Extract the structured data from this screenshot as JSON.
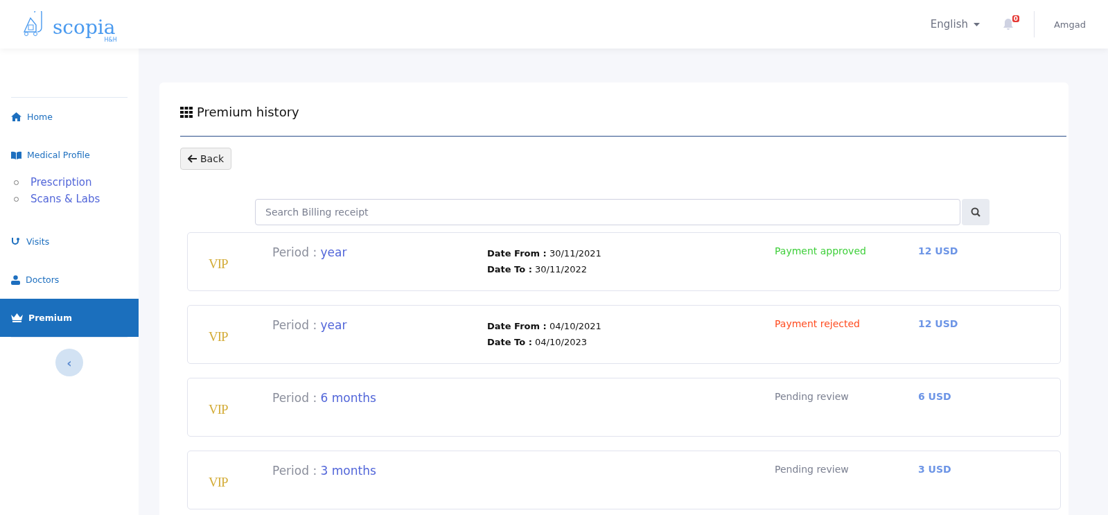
{
  "header": {
    "logo": {
      "name": "scopia",
      "tagline": "H&H"
    },
    "language": "English",
    "notifications": "0",
    "user": "Amgad"
  },
  "sidebar": {
    "items": [
      {
        "label": "Home",
        "selected": false
      },
      {
        "label": "Medical Profile",
        "selected": false,
        "children": [
          {
            "label": "Prescription"
          },
          {
            "label": "Scans & Labs"
          }
        ]
      },
      {
        "label": "Visits",
        "selected": false
      },
      {
        "label": "Doctors",
        "selected": false
      },
      {
        "label": "Premium",
        "selected": true
      }
    ],
    "collapse": "‹"
  },
  "page": {
    "title": "Premium history",
    "back": "Back",
    "search": {
      "placeholder": "Search Billing receipt"
    },
    "rows": [
      {
        "badge": "VIP",
        "period_label": "Period :",
        "period": "year",
        "date_from_label": "Date From :",
        "date_from": "30/11/2021",
        "date_to_label": "Date To :",
        "date_to": "30/11/2022",
        "status": "Payment approved",
        "kind": "approved",
        "amount": "12 USD"
      },
      {
        "badge": "VIP",
        "period_label": "Period :",
        "period": "year",
        "date_from_label": "Date From :",
        "date_from": "04/10/2021",
        "date_to_label": "Date To :",
        "date_to": "04/10/2023",
        "status": "Payment rejected",
        "kind": "rejected",
        "amount": "12 USD"
      },
      {
        "badge": "VIP",
        "period_label": "Period :",
        "period": "6 months",
        "status": "Pending review",
        "kind": "pending",
        "amount": "6 USD"
      },
      {
        "badge": "VIP",
        "period_label": "Period :",
        "period": "3 months",
        "status": "Pending review",
        "kind": "pending",
        "amount": "3 USD"
      }
    ]
  }
}
